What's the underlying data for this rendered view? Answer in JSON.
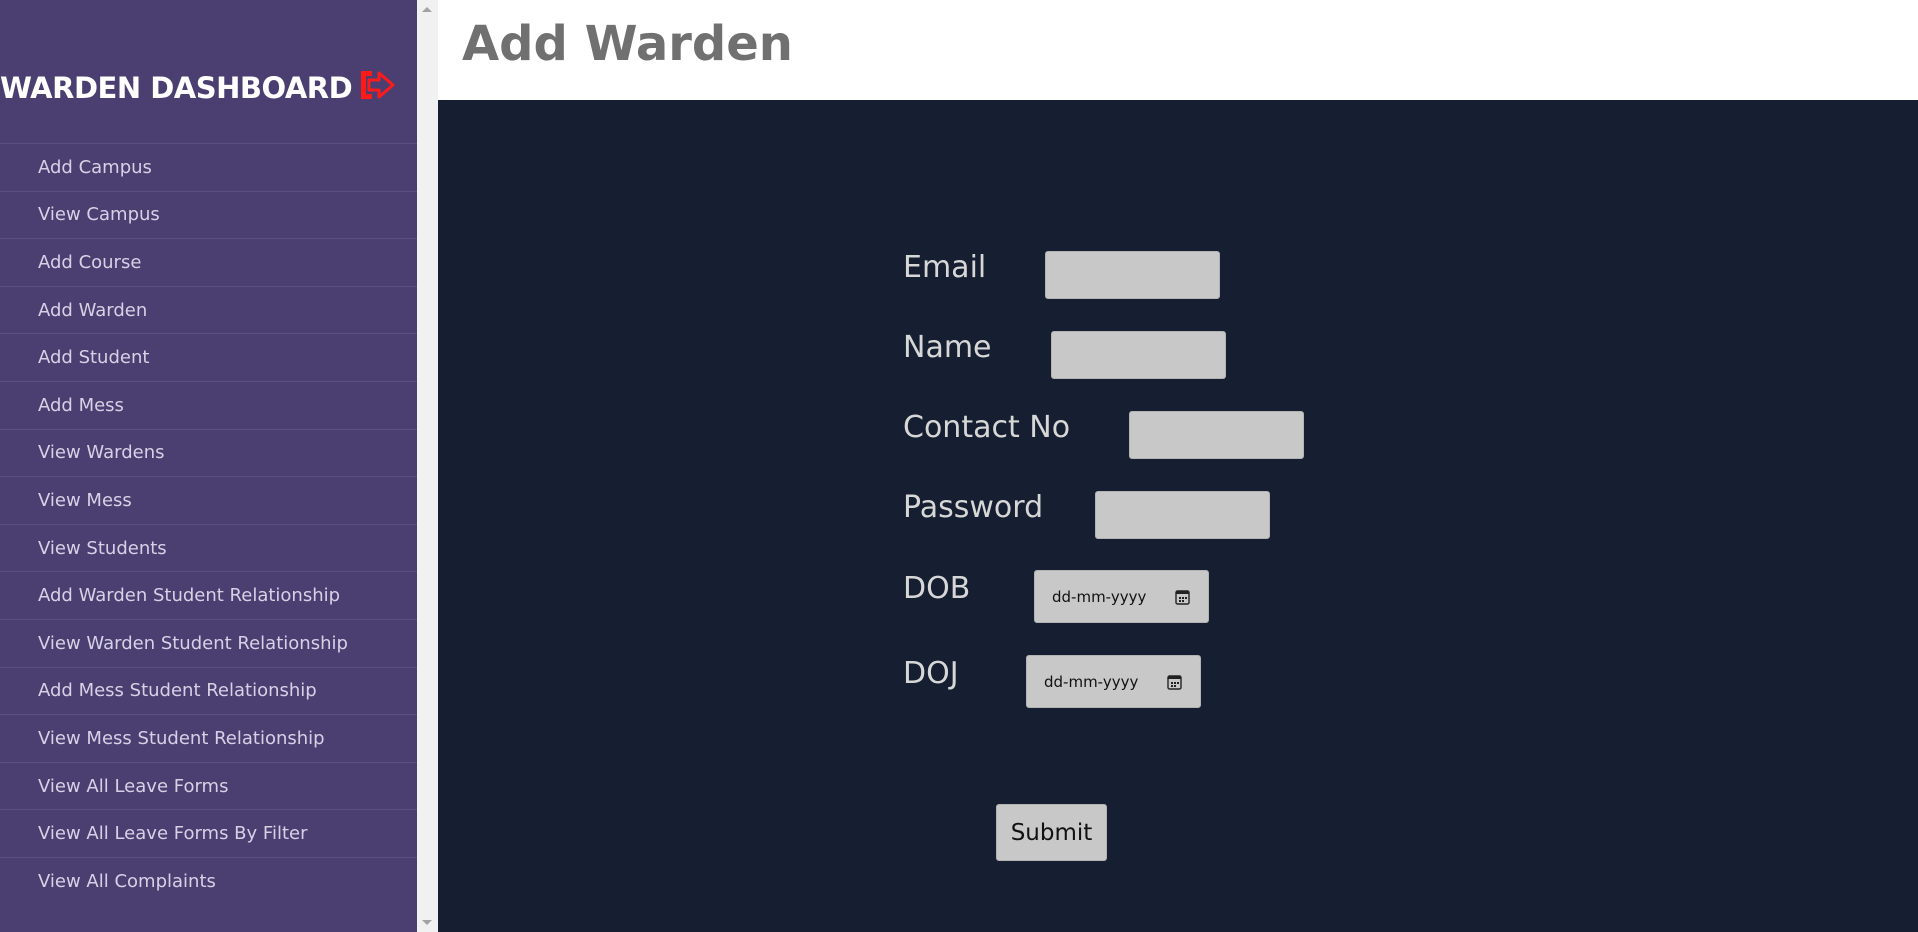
{
  "sidebar": {
    "title": "WARDEN DASHBOARD",
    "logout_icon": "sign-out-icon",
    "accent_color": "#ff1a1a",
    "background_color": "#4b3f72",
    "items": [
      {
        "label": "Add Campus"
      },
      {
        "label": "View Campus"
      },
      {
        "label": "Add Course"
      },
      {
        "label": "Add Warden"
      },
      {
        "label": "Add Student"
      },
      {
        "label": "Add Mess"
      },
      {
        "label": "View Wardens"
      },
      {
        "label": "View Mess"
      },
      {
        "label": "View Students"
      },
      {
        "label": "Add Warden Student Relationship"
      },
      {
        "label": "View Warden Student Relationship"
      },
      {
        "label": "Add Mess Student Relationship"
      },
      {
        "label": "View Mess Student Relationship"
      },
      {
        "label": "View All Leave Forms"
      },
      {
        "label": "View All Leave Forms By Filter"
      },
      {
        "label": "View All Complaints"
      }
    ]
  },
  "header": {
    "title": "Add Warden"
  },
  "form": {
    "background_color": "#161e31",
    "email": {
      "label": "Email",
      "value": ""
    },
    "name": {
      "label": "Name",
      "value": ""
    },
    "contact": {
      "label": "Contact No",
      "value": ""
    },
    "password": {
      "label": "Password",
      "value": ""
    },
    "dob": {
      "label": "DOB",
      "placeholder": "dd-mm-yyyy",
      "icon": "calendar-icon"
    },
    "doj": {
      "label": "DOJ",
      "placeholder": "dd-mm-yyyy",
      "icon": "calendar-icon"
    },
    "submit_label": "Submit"
  }
}
